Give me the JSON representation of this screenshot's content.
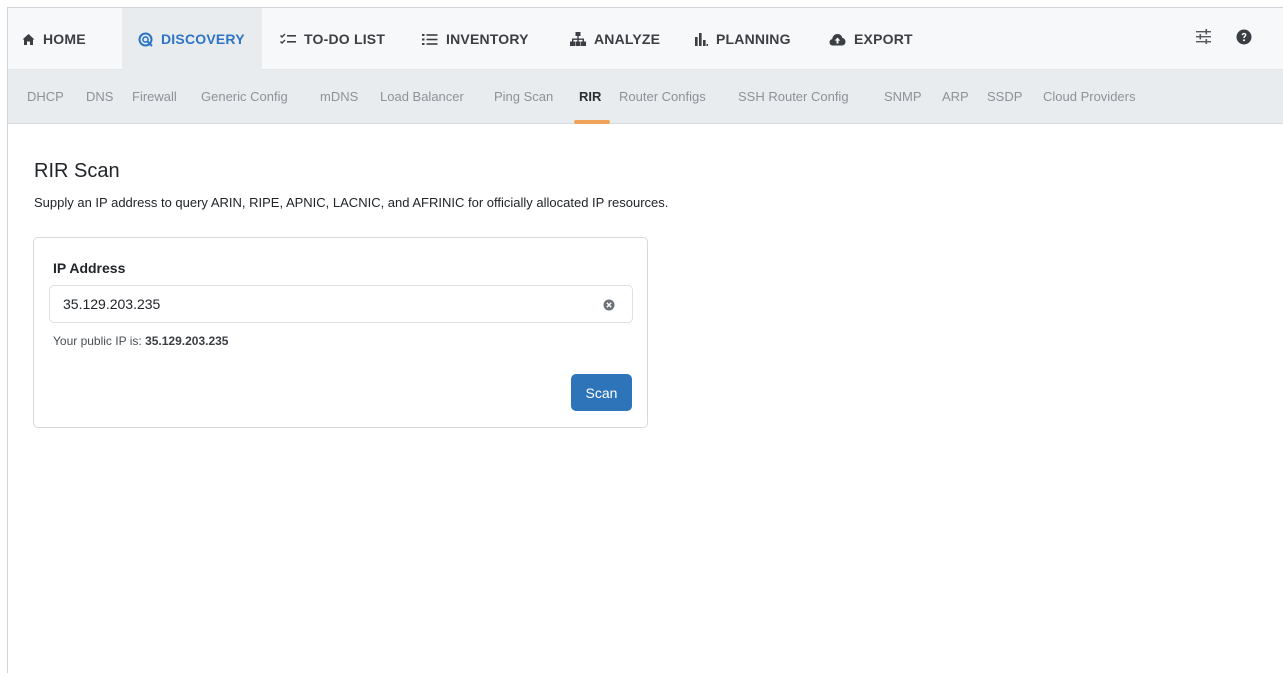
{
  "topnav": {
    "tabs": [
      {
        "label": "HOME",
        "icon": "home-icon"
      },
      {
        "label": "DISCOVERY",
        "icon": "discovery-radar-icon",
        "active": true
      },
      {
        "label": "TO-DO LIST",
        "icon": "todo-list-icon"
      },
      {
        "label": "INVENTORY",
        "icon": "list-icon"
      },
      {
        "label": "ANALYZE",
        "icon": "sitemap-icon"
      },
      {
        "label": "PLANNING",
        "icon": "bar-chart-icon"
      },
      {
        "label": "EXPORT",
        "icon": "cloud-upload-icon"
      }
    ],
    "tools": [
      "sliders-icon",
      "help-circle-icon"
    ]
  },
  "subnav": {
    "items": [
      "DHCP",
      "DNS",
      "Firewall",
      "Generic Config",
      "mDNS",
      "Load Balancer",
      "Ping Scan",
      "RIR",
      "Router Configs",
      "SSH Router Config",
      "SNMP",
      "ARP",
      "SSDP",
      "Cloud Providers"
    ],
    "active": "RIR"
  },
  "page": {
    "title": "RIR Scan",
    "description": "Supply an IP address to query ARIN, RIPE, APNIC, LACNIC, and AFRINIC for officially allocated IP resources."
  },
  "form": {
    "ip_label": "IP Address",
    "ip_value": "35.129.203.235",
    "hint_prefix": "Your public IP is: ",
    "public_ip": "35.129.203.235",
    "scan_label": "Scan"
  },
  "colors": {
    "accent": "#2d74c4",
    "button": "#2d74b8",
    "active_underline": "#f0a35a"
  }
}
